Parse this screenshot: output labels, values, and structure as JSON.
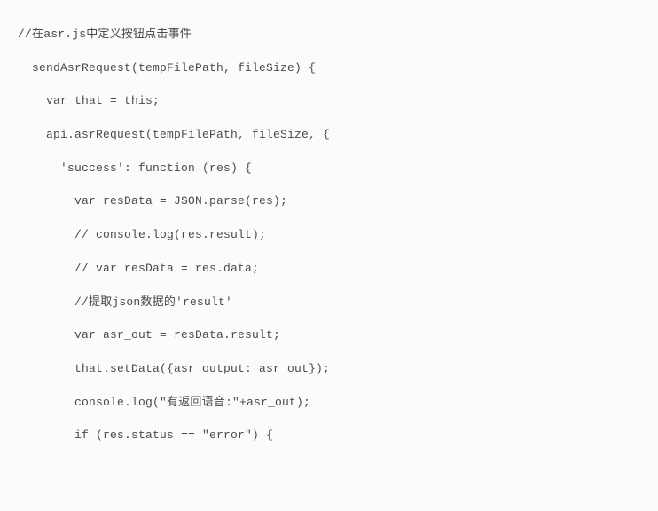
{
  "code": {
    "lines": [
      "//在asr.js中定义按钮点击事件",
      "",
      "",
      "  sendAsrRequest(tempFilePath, fileSize) {",
      "",
      "    var that = this;",
      "",
      "    api.asrRequest(tempFilePath, fileSize, {",
      "",
      "      'success': function (res) {",
      "",
      "        var resData = JSON.parse(res);",
      "",
      "        // console.log(res.result);",
      "",
      "        // var resData = res.data;",
      "",
      "        //提取json数据的'result'",
      "",
      "        var asr_out = resData.result;",
      "",
      "        that.setData({asr_output: asr_out});",
      "",
      "        console.log(\"有返回语音:\"+asr_out);",
      "",
      "        if (res.status == \"error\") {"
    ]
  }
}
